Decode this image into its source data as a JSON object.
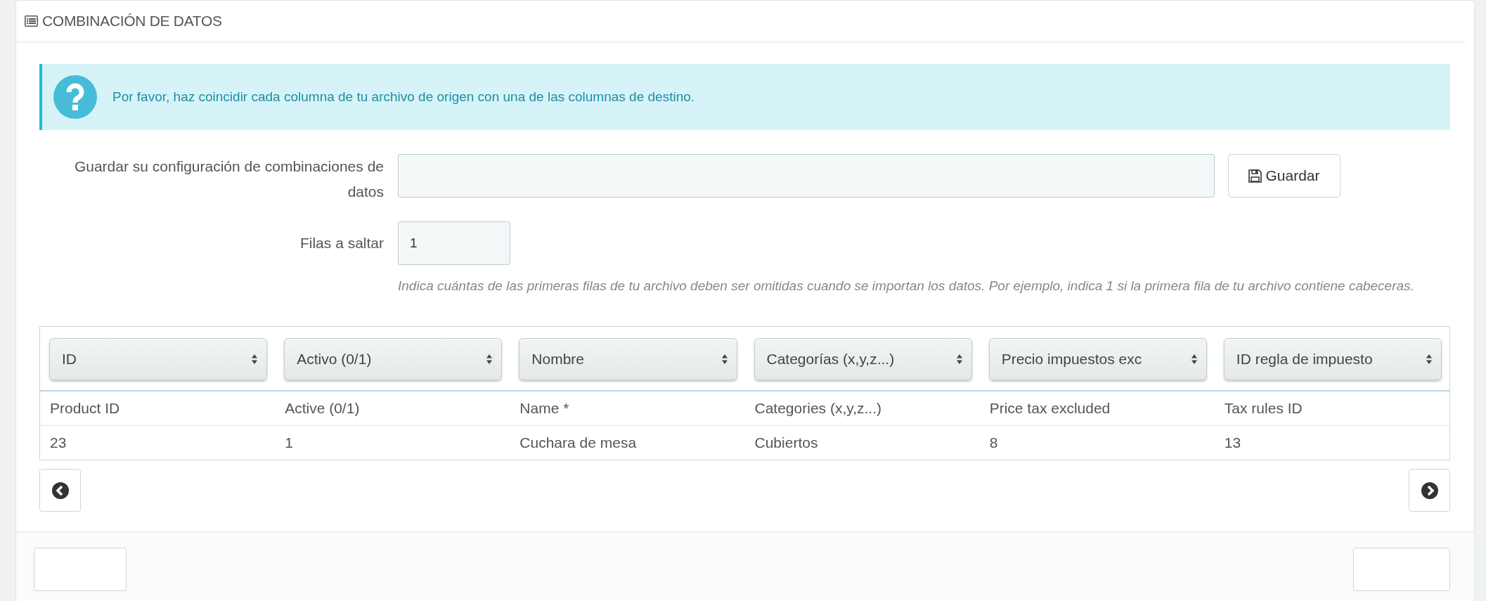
{
  "panel": {
    "title": "COMBINACIÓN DE DATOS"
  },
  "alert": {
    "text": "Por favor, haz coincidir cada columna de tu archivo de origen con una de las columnas de destino."
  },
  "save_config": {
    "label": "Guardar su configuración de combinaciones de datos",
    "button": "Guardar"
  },
  "skip_rows": {
    "label": "Filas a saltar",
    "value": "1",
    "help": "Indica cuántas de las primeras filas de tu archivo deben ser omitidas cuando se importan los datos. Por ejemplo, indica 1 si la primera fila de tu archivo contiene cabeceras."
  },
  "table": {
    "columns": [
      {
        "select": "ID",
        "header": "Product ID"
      },
      {
        "select": "Activo (0/1)",
        "header": "Active (0/1)"
      },
      {
        "select": "Nombre",
        "header": "Name *"
      },
      {
        "select": "Categorías (x,y,z...)",
        "header": "Categories (x,y,z...)"
      },
      {
        "select": "Precio impuestos exc",
        "header": "Price tax excluded"
      },
      {
        "select": "ID regla de impuesto",
        "header": "Tax rules ID"
      }
    ],
    "rows": [
      [
        "23",
        "1",
        "Cuchara de mesa",
        "Cubiertos",
        "8",
        "13"
      ]
    ]
  }
}
